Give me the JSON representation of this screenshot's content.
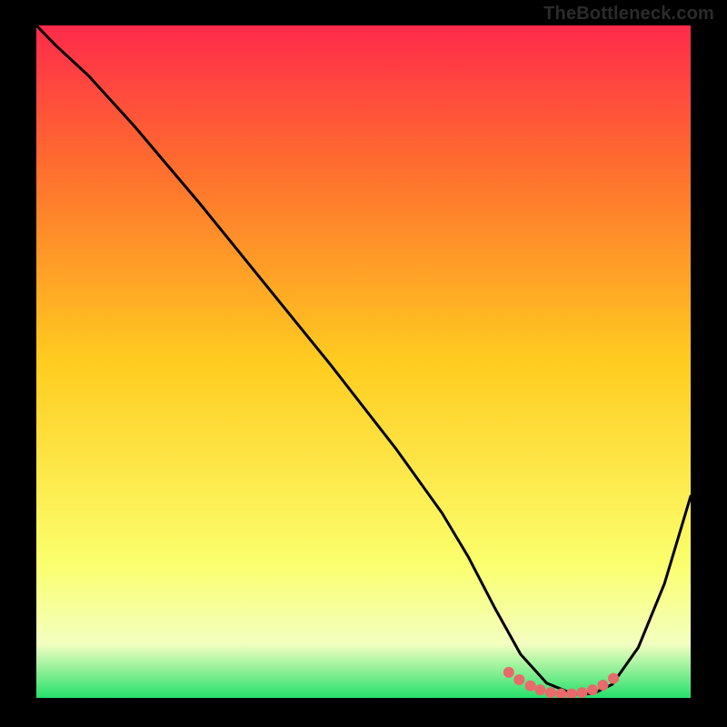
{
  "header": {
    "attribution": "TheBottleneck.com"
  },
  "colors": {
    "background": "#000000",
    "gradient_top": "#ff2a4b",
    "gradient_upper": "#ff6a2f",
    "gradient_mid": "#ffcc1f",
    "gradient_low": "#fbff6d",
    "gradient_pale": "#f3ffc0",
    "gradient_bottom": "#25e06b",
    "curve": "#000000",
    "marker": "#e86a6a"
  },
  "chart_data": {
    "type": "line",
    "title": "",
    "xlabel": "",
    "ylabel": "",
    "xlim": [
      0,
      100
    ],
    "ylim": [
      0,
      100
    ],
    "grid": false,
    "legend": false,
    "series": [
      {
        "name": "curve",
        "x": [
          0,
          3,
          8,
          15,
          25,
          35,
          45,
          55,
          62,
          66,
          70,
          74,
          78,
          82,
          85,
          88,
          92,
          96,
          100
        ],
        "y": [
          100,
          97,
          92.5,
          85,
          73.5,
          61.5,
          49.5,
          37,
          27.5,
          21,
          13.5,
          6.5,
          2.2,
          0.6,
          0.6,
          2.0,
          7.5,
          17,
          30
        ]
      }
    ],
    "markers": {
      "name": "highlight-dots",
      "x": [
        72.2,
        73.8,
        75.5,
        77.0,
        78.6,
        80.2,
        81.8,
        83.4,
        85.0,
        86.6,
        88.2
      ],
      "y": [
        3.8,
        2.7,
        1.8,
        1.2,
        0.8,
        0.6,
        0.6,
        0.8,
        1.2,
        1.9,
        2.9
      ]
    }
  }
}
